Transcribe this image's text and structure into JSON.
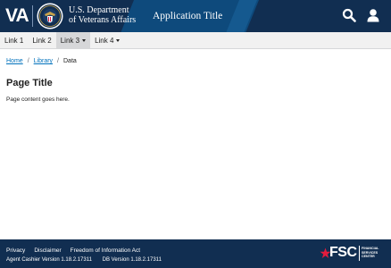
{
  "header": {
    "va_mark": "VA",
    "dept_line1": "U.S. Department",
    "dept_line2": "of Veterans Affairs",
    "app_title": "Application Title",
    "icons": [
      "search-icon",
      "user-icon"
    ]
  },
  "nav": {
    "items": [
      {
        "label": "Link 1",
        "dropdown": false,
        "active": false
      },
      {
        "label": "Link 2",
        "dropdown": false,
        "active": false
      },
      {
        "label": "Link 3",
        "dropdown": true,
        "active": true
      },
      {
        "label": "Link 4",
        "dropdown": true,
        "active": false
      }
    ]
  },
  "breadcrumb": {
    "items": [
      "Home",
      "Library",
      "Data"
    ],
    "separator": "/"
  },
  "main": {
    "title": "Page Title",
    "body": "Page content goes here."
  },
  "footer": {
    "links": [
      "Privacy",
      "Disclaimer",
      "Freedom of Information Act"
    ],
    "agent_version": "Agent Cashier Version 1.18.2.17311",
    "db_version": "DB Version 1.18.2.17311",
    "logo_text": "FSC",
    "logo_sub": [
      "FINANCIAL",
      "SERVICES",
      "CENTER"
    ]
  },
  "colors": {
    "header_bg": "#112e51",
    "header_band": "#0e4a7c",
    "nav_bg": "#f1f1f1",
    "nav_active": "#d6d7d9",
    "link": "#0071bc",
    "footer_bg": "#112e51",
    "logo_star": "#e31c3d"
  }
}
